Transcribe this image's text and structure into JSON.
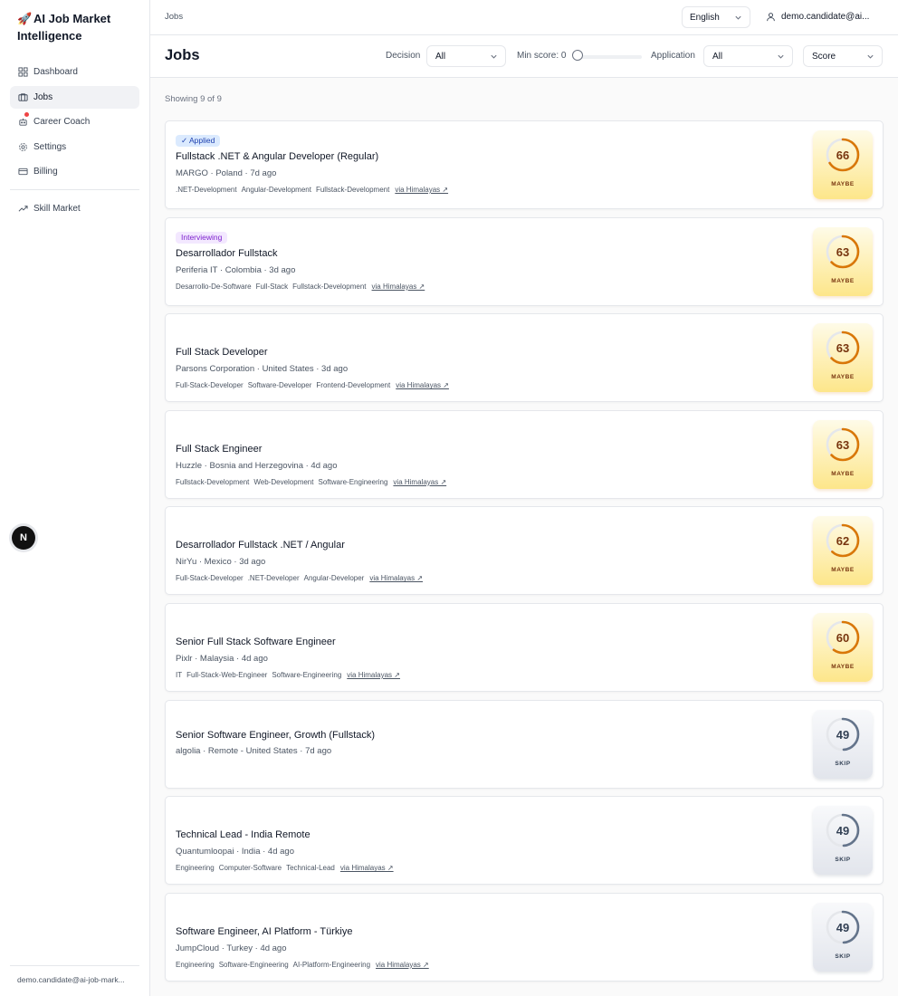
{
  "app": {
    "brand_icon": "🚀",
    "brand_title": "AI Job Market Intelligence"
  },
  "sidebar": {
    "items": [
      {
        "label": "Dashboard",
        "icon": "dashboard-icon"
      },
      {
        "label": "Jobs",
        "icon": "briefcase-icon",
        "active": true
      },
      {
        "label": "Career Coach",
        "icon": "bot-icon"
      },
      {
        "label": "Settings",
        "icon": "gear-icon"
      },
      {
        "label": "Billing",
        "icon": "credit-card-icon"
      }
    ],
    "secondary": [
      {
        "label": "Skill Market",
        "icon": "trending-up-icon"
      }
    ],
    "footer_email": "demo.candidate@ai-job-mark..."
  },
  "topbar": {
    "breadcrumb": "Jobs",
    "language": "English",
    "user": "demo.candidate@ai..."
  },
  "header": {
    "title": "Jobs",
    "decision_label": "Decision",
    "decision_value": "All",
    "min_score_label": "Min score: 0",
    "min_score": 0,
    "application_label": "Application",
    "application_value": "All",
    "sort_value": "Score"
  },
  "showing": "Showing 9 of 9",
  "jobs": [
    {
      "badge": "✓ Applied",
      "badge_type": "applied",
      "title": "Fullstack .NET & Angular Developer (Regular)",
      "meta": "MARGO · Poland · 7d ago",
      "tags": [
        ".NET-Development",
        "Angular-Development",
        "Fullstack-Development"
      ],
      "via": "via Himalayas ↗",
      "score": "66",
      "score_value": 66,
      "decision": "MAYBE"
    },
    {
      "badge": "Interviewing",
      "badge_type": "interviewing",
      "title": "Desarrollador Fullstack",
      "meta": "Periferia IT · Colombia · 3d ago",
      "tags": [
        "Desarrollo-De-Software",
        "Full-Stack",
        "Fullstack-Development"
      ],
      "via": "via Himalayas ↗",
      "score": "63",
      "score_value": 63,
      "decision": "MAYBE"
    },
    {
      "title": "Full Stack Developer",
      "meta": "Parsons Corporation · United States · 3d ago",
      "tags": [
        "Full-Stack-Developer",
        "Software-Developer",
        "Frontend-Development"
      ],
      "via": "via Himalayas ↗",
      "score": "63",
      "score_value": 63,
      "decision": "MAYBE"
    },
    {
      "title": "Full Stack Engineer",
      "meta": "Huzzle · Bosnia and Herzegovina · 4d ago",
      "tags": [
        "Fullstack-Development",
        "Web-Development",
        "Software-Engineering"
      ],
      "via": "via Himalayas ↗",
      "score": "63",
      "score_value": 63,
      "decision": "MAYBE"
    },
    {
      "title": "Desarrollador Fullstack .NET / Angular",
      "meta": "NirYu · Mexico · 3d ago",
      "tags": [
        "Full-Stack-Developer",
        ".NET-Developer",
        "Angular-Developer"
      ],
      "via": "via Himalayas ↗",
      "score": "62",
      "score_value": 62,
      "decision": "MAYBE"
    },
    {
      "title": "Senior Full Stack Software Engineer",
      "meta": "Pixlr · Malaysia · 4d ago",
      "tags": [
        "IT",
        "Full-Stack-Web-Engineer",
        "Software-Engineering"
      ],
      "via": "via Himalayas ↗",
      "score": "60",
      "score_value": 60,
      "decision": "MAYBE"
    },
    {
      "title": "Senior Software Engineer, Growth (Fullstack)",
      "meta": "algolia · Remote - United States · 7d ago",
      "tags": [],
      "score": "49",
      "score_value": 49,
      "decision": "SKIP"
    },
    {
      "title": "Technical Lead - India Remote",
      "meta": "Quantumloopai · India · 4d ago",
      "tags": [
        "Engineering",
        "Computer-Software",
        "Technical-Lead"
      ],
      "via": "via Himalayas ↗",
      "score": "49",
      "score_value": 49,
      "decision": "SKIP"
    },
    {
      "title": "Software Engineer, AI Platform - Türkiye",
      "meta": "JumpCloud · Turkey · 4d ago",
      "tags": [
        "Engineering",
        "Software-Engineering",
        "AI-Platform-Engineering"
      ],
      "via": "via Himalayas ↗",
      "score": "49",
      "score_value": 49,
      "decision": "SKIP"
    }
  ],
  "colors": {
    "maybe_ring": "#d97706",
    "skip_ring": "#64748b",
    "ring_track": "#e5e7eb"
  }
}
